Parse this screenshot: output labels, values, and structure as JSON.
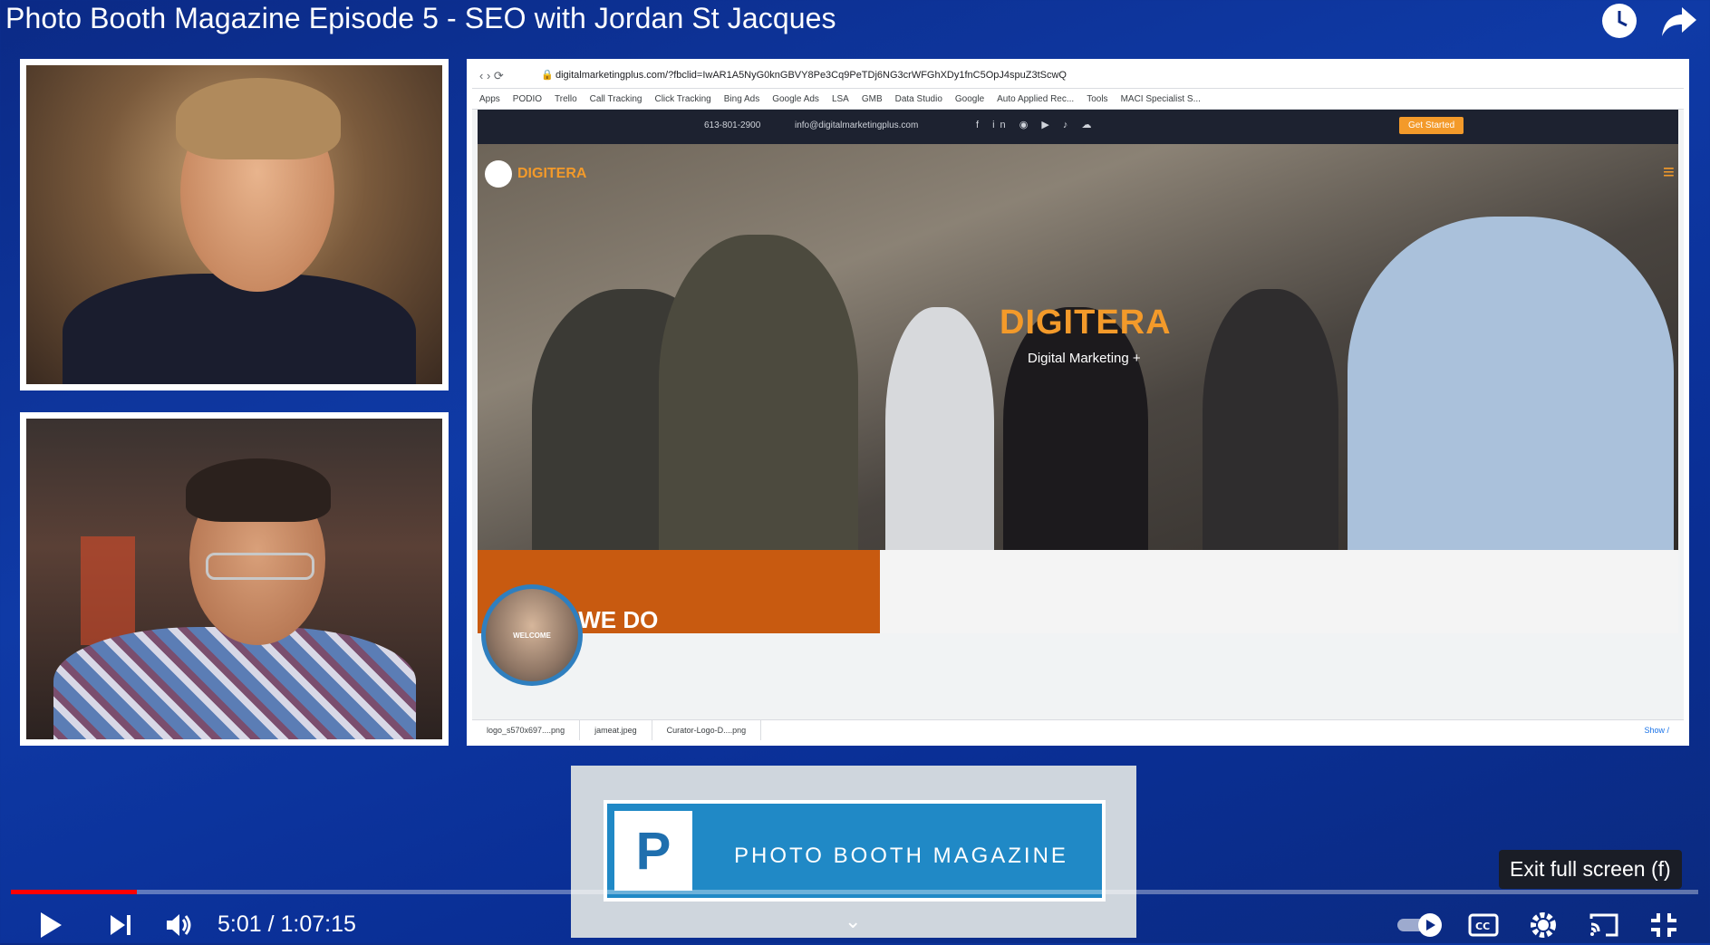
{
  "title": "Photo Booth Magazine Episode 5 - SEO with Jordan St Jacques",
  "top_icons": [
    "watch-later-icon",
    "share-icon"
  ],
  "browser": {
    "url": "digitalmarketingplus.com/?fbclid=IwAR1A5NyG0knGBVY8Pe3Cq9PeTDj6NG3crWFGhXDy1fnC5OpJ4spuZ3tScwQ",
    "bookmarks": [
      "Apps",
      "PODIO",
      "Trello",
      "Call Tracking",
      "Click Tracking",
      "Bing Ads",
      "Google Ads",
      "LSA",
      "GMB",
      "Data Studio",
      "Google",
      "Auto Applied Rec...",
      "Tools",
      "MACI Specialist S..."
    ],
    "site": {
      "phone": "613-801-2900",
      "email": "info@digitalmarketingplus.com",
      "cta": "Get Started",
      "logo": "DIGITERA",
      "hero_title": "DIGITERA",
      "hero_subtitle": "Digital Marketing +",
      "section_heading": "WHAT WE DO",
      "welcome_label": "WELCOME"
    },
    "downloads": [
      "logo_s570x697....png",
      "jameat.jpeg",
      "Curator-Logo-D....png"
    ],
    "show_all": "Show /"
  },
  "logo_card": {
    "letter": "P",
    "text": "PHOTO BOOTH MAGAZINE"
  },
  "player": {
    "current_time": "5:01",
    "duration": "1:07:15",
    "time_display": "5:01 / 1:07:15",
    "progress": 0.0746,
    "tooltip": "Exit full screen (f)",
    "accent": "#ff0000"
  }
}
